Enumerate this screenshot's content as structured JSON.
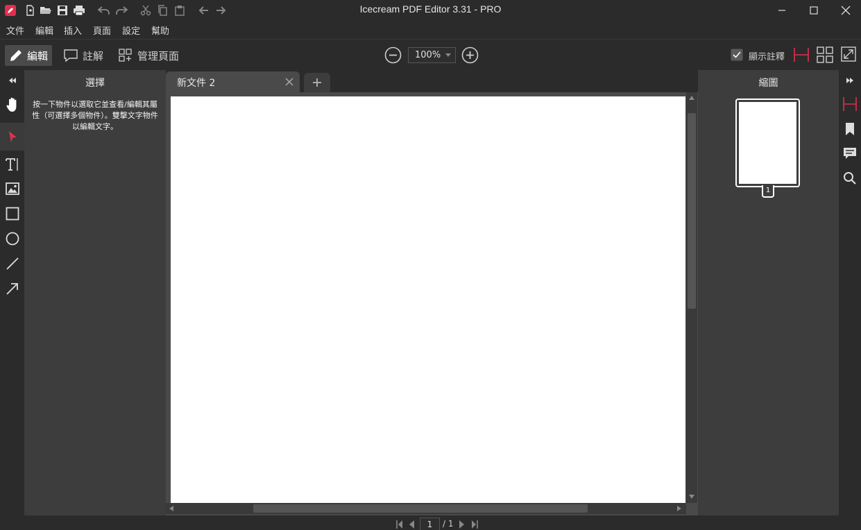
{
  "window": {
    "title": "Icecream PDF Editor 3.31 - PRO"
  },
  "menu": {
    "items": [
      "文件",
      "編輯",
      "插入",
      "頁面",
      "設定",
      "幫助"
    ]
  },
  "toolbar": {
    "modes": [
      {
        "label": "編輯",
        "icon": "pencil-icon",
        "active": true
      },
      {
        "label": "註解",
        "icon": "comment-icon",
        "active": false
      },
      {
        "label": "管理頁面",
        "icon": "pages-grid-icon",
        "active": false
      }
    ],
    "zoom": "100%",
    "show_annotations_label": "顯示註釋",
    "show_annotations_checked": true
  },
  "tools": [
    "hand-icon",
    "select-arrow-icon",
    "text-icon",
    "image-icon",
    "rectangle-icon",
    "ellipse-icon",
    "line-icon",
    "arrow-icon"
  ],
  "left_panel": {
    "title": "選擇",
    "description": "按一下物件以選取它並查看/編輯其屬性（可選擇多個物件）。雙擊文字物件以編輯文字。"
  },
  "document": {
    "tab_label": "新文件 2"
  },
  "right_panel": {
    "title": "縮圖",
    "thumbnail_page": "1"
  },
  "status": {
    "current_page": "1",
    "total_pages": "/ 1"
  },
  "colors": {
    "accent": "#e0304e",
    "background": "#2b2b2b",
    "panel": "#3d3d3d"
  }
}
